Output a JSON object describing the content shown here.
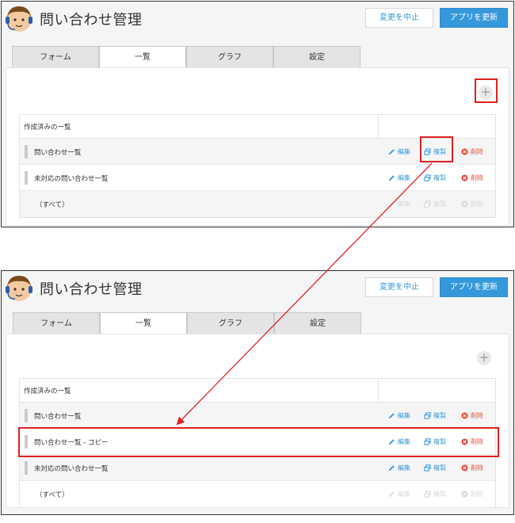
{
  "app": {
    "title": "問い合わせ管理"
  },
  "header": {
    "cancel_label": "変更を中止",
    "update_label": "アプリを更新"
  },
  "tabs": [
    "フォーム",
    "一覧",
    "グラフ",
    "設定"
  ],
  "list": {
    "heading": "作成済みの一覧"
  },
  "actions": {
    "edit": "編集",
    "copy": "複製",
    "delete": "削除"
  },
  "before": {
    "rows": [
      "問い合わせ一覧",
      "未対応の問い合わせ一覧",
      "（すべて）"
    ]
  },
  "after": {
    "rows": [
      "問い合わせ一覧",
      "問い合わせ一覧 - コピー",
      "未対応の問い合わせ一覧",
      "（すべて）"
    ]
  },
  "colors": {
    "accent": "#3498db",
    "danger": "#e74c3c",
    "highlight": "#e02020"
  },
  "icons": [
    "avatar-icon",
    "plus-icon",
    "pencil-icon",
    "copy-icon",
    "delete-icon",
    "drag-handle-icon"
  ]
}
